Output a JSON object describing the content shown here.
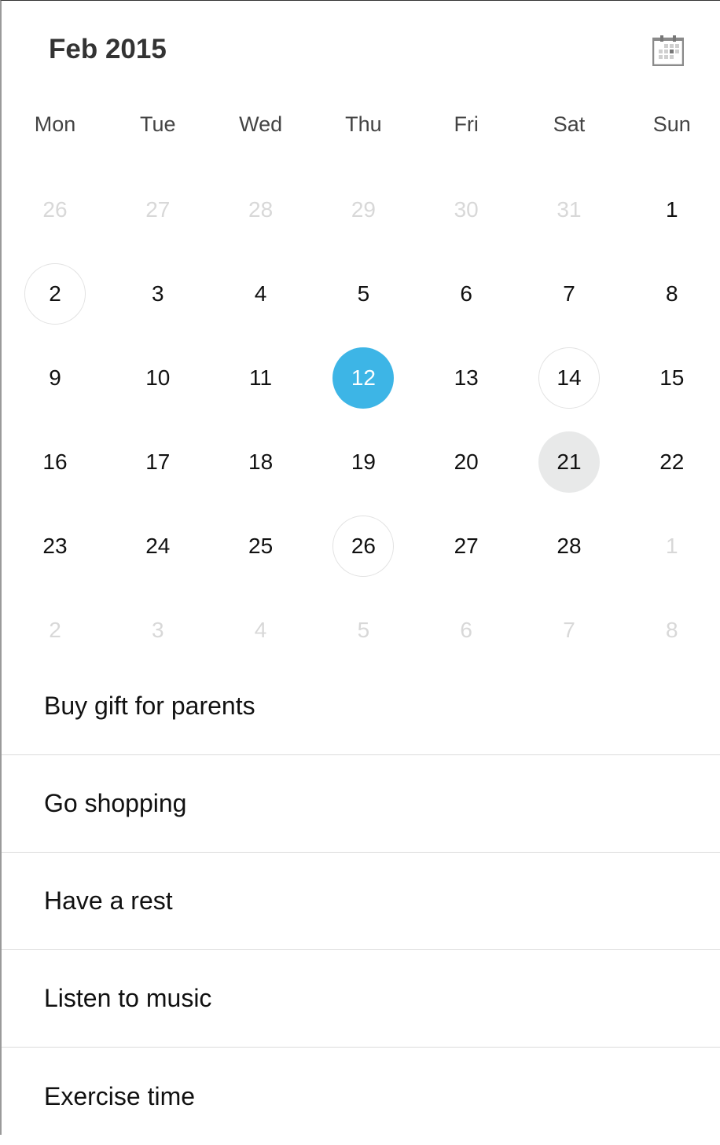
{
  "header": {
    "title": "Feb 2015",
    "calendar_icon": "calendar-icon"
  },
  "weekdays": [
    "Mon",
    "Tue",
    "Wed",
    "Thu",
    "Fri",
    "Sat",
    "Sun"
  ],
  "colors": {
    "selected": "#3db5e6",
    "pressed": "#e8e9e9",
    "outline": "#e2e2e2",
    "other_month": "#d8d8d8"
  },
  "selected_day": 12,
  "weeks": [
    [
      {
        "d": "26",
        "o": true
      },
      {
        "d": "27",
        "o": true
      },
      {
        "d": "28",
        "o": true
      },
      {
        "d": "29",
        "o": true
      },
      {
        "d": "30",
        "o": true
      },
      {
        "d": "31",
        "o": true
      },
      {
        "d": "1"
      }
    ],
    [
      {
        "d": "2",
        "s": "outlined"
      },
      {
        "d": "3"
      },
      {
        "d": "4"
      },
      {
        "d": "5"
      },
      {
        "d": "6"
      },
      {
        "d": "7"
      },
      {
        "d": "8"
      }
    ],
    [
      {
        "d": "9"
      },
      {
        "d": "10"
      },
      {
        "d": "11"
      },
      {
        "d": "12",
        "s": "selected"
      },
      {
        "d": "13"
      },
      {
        "d": "14",
        "s": "outlined"
      },
      {
        "d": "15"
      }
    ],
    [
      {
        "d": "16"
      },
      {
        "d": "17"
      },
      {
        "d": "18"
      },
      {
        "d": "19"
      },
      {
        "d": "20"
      },
      {
        "d": "21",
        "s": "pressed"
      },
      {
        "d": "22"
      }
    ],
    [
      {
        "d": "23"
      },
      {
        "d": "24"
      },
      {
        "d": "25"
      },
      {
        "d": "26",
        "s": "outlined"
      },
      {
        "d": "27"
      },
      {
        "d": "28"
      },
      {
        "d": "1",
        "o": true
      }
    ],
    [
      {
        "d": "2",
        "o": true
      },
      {
        "d": "3",
        "o": true
      },
      {
        "d": "4",
        "o": true
      },
      {
        "d": "5",
        "o": true
      },
      {
        "d": "6",
        "o": true
      },
      {
        "d": "7",
        "o": true
      },
      {
        "d": "8",
        "o": true
      }
    ]
  ],
  "events": [
    "Buy gift for parents",
    "Go shopping",
    "Have a rest",
    "Listen to music",
    "Exercise time"
  ]
}
